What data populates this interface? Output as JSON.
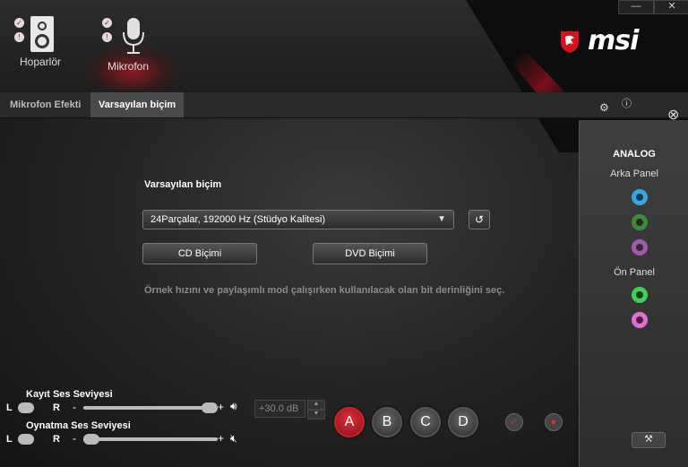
{
  "window": {
    "minimize_label": "—",
    "close_label": "✕"
  },
  "brand": {
    "logo_text": "msi"
  },
  "devices": [
    {
      "label": "Hoparlör",
      "icon": "speaker-icon",
      "active": false
    },
    {
      "label": "Mikrofon",
      "icon": "microphone-icon",
      "active": true
    }
  ],
  "tabs": [
    {
      "label": "Mikrofon Efekti",
      "active": false
    },
    {
      "label": "Varsayılan biçim",
      "active": true
    }
  ],
  "main": {
    "heading": "Varsayılan biçim",
    "format_value": "24Parçalar, 192000 Hz (Stüdyo Kalitesi)",
    "cd_button": "CD Biçimi",
    "dvd_button": "DVD Biçimi",
    "description": "Örnek hızını ve paylaşımlı mod çalışırken kullanılacak olan bit derinliğini seç."
  },
  "right_panel": {
    "title": "ANALOG",
    "rear_label": "Arka Panel",
    "front_label": "Ön Panel",
    "rear_jacks": [
      "#3aa7e0",
      "#3c8a3c",
      "#a05aa8"
    ],
    "front_jacks": [
      "#3ccf5a",
      "#e070d0"
    ]
  },
  "levels": {
    "record_title": "Kayıt Ses Seviyesi",
    "playback_title": "Oynatma Ses Seviyesi",
    "left_label": "L",
    "right_label": "R",
    "plus": "+",
    "minus": "-",
    "db_value": "+30.0 dB",
    "record_level": 1.0,
    "playback_level": 0.0
  },
  "abcd": [
    {
      "label": "A",
      "active": true
    },
    {
      "label": "B",
      "active": false
    },
    {
      "label": "C",
      "active": false
    },
    {
      "label": "D",
      "active": false
    }
  ],
  "colors": {
    "accent": "#c8141e",
    "background": "#262626"
  }
}
